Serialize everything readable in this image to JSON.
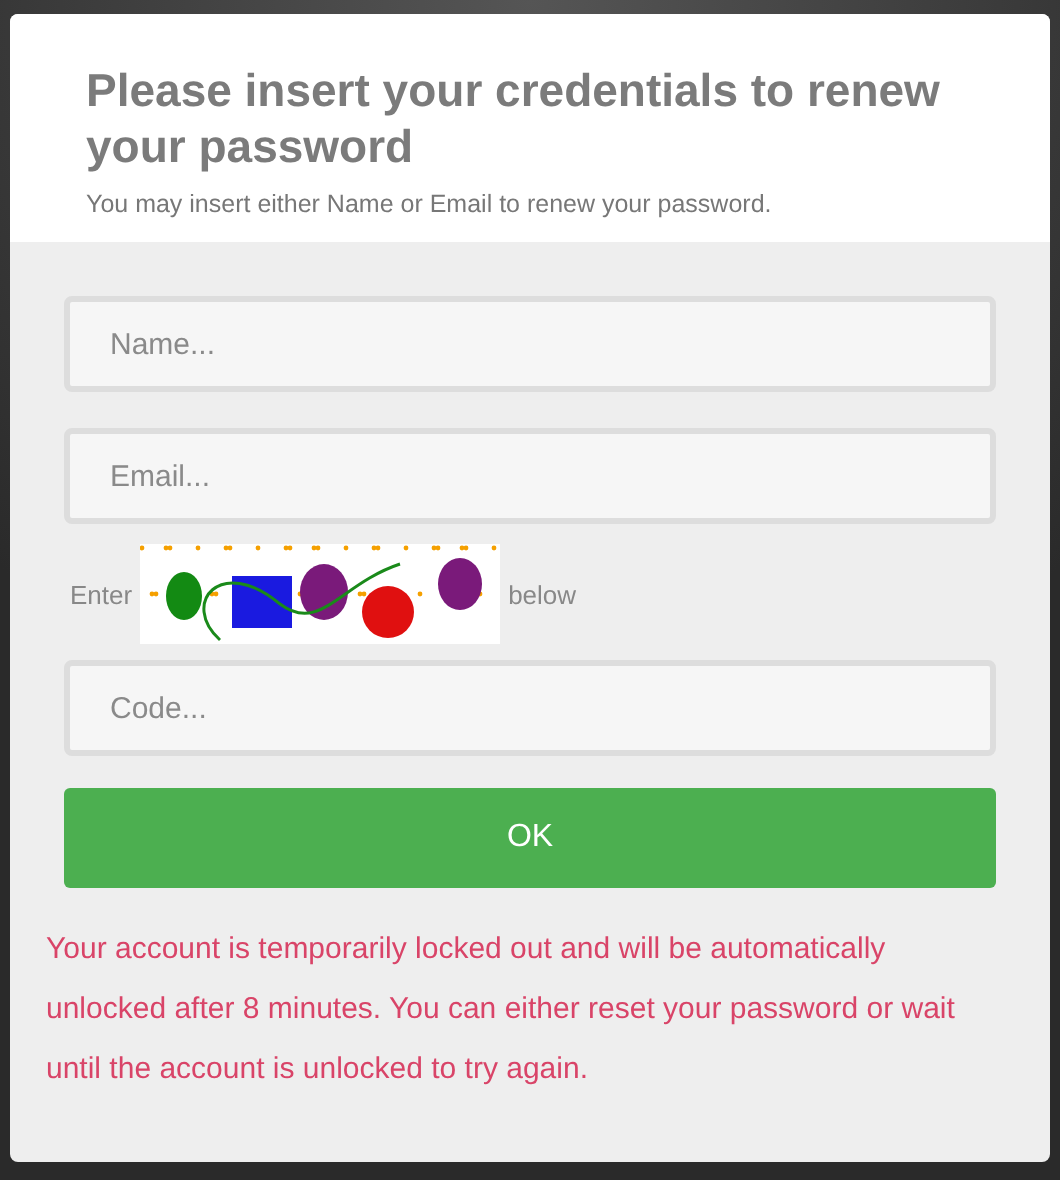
{
  "header": {
    "title": "Please insert your credentials to renew your password",
    "subtitle": "You may insert either Name or Email to renew your password."
  },
  "fields": [
    {
      "placeholder": "Name..."
    },
    {
      "placeholder": "Email..."
    }
  ],
  "captcha": {
    "before": "Enter",
    "after": "below",
    "kind": "picture"
  },
  "code_field": {
    "placeholder": "Code..."
  },
  "button": "OK",
  "error": "Your account is temporarily locked out and will be automatically unlocked after 8 minutes. You can either reset your password or wait until the account is unlocked to try again."
}
